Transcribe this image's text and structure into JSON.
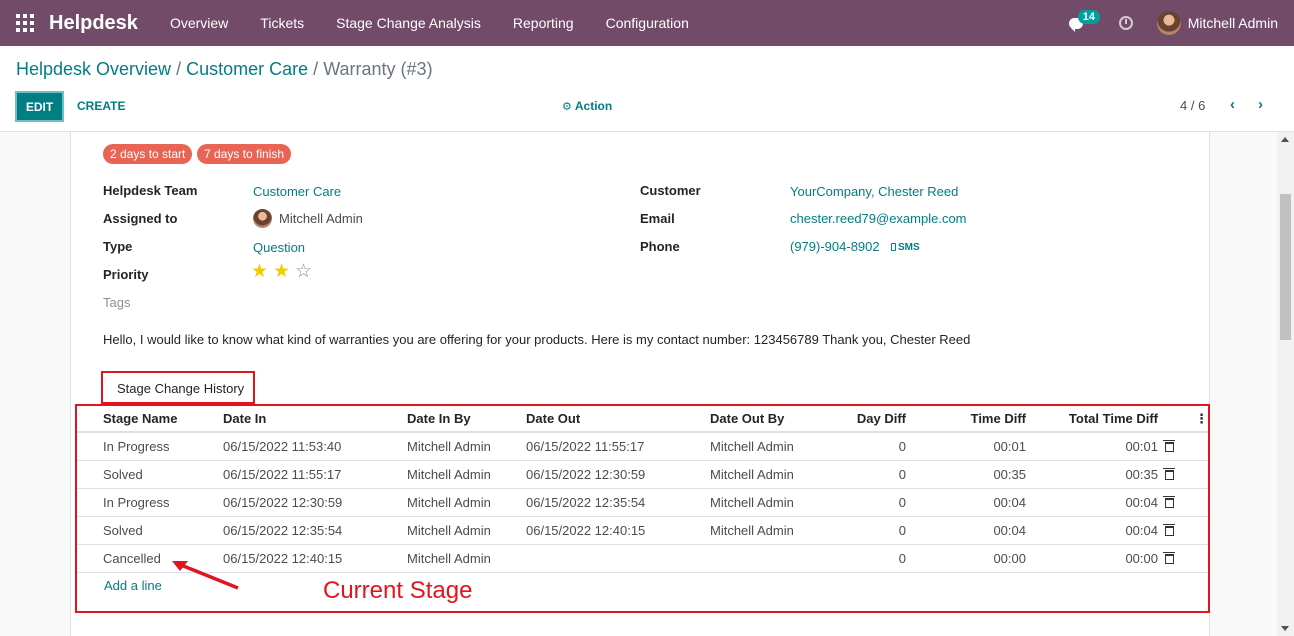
{
  "navbar": {
    "brand": "Helpdesk",
    "menu": [
      "Overview",
      "Tickets",
      "Stage Change Analysis",
      "Reporting",
      "Configuration"
    ],
    "message_count": "14",
    "user": "Mitchell Admin"
  },
  "control": {
    "breadcrumb": [
      "Helpdesk Overview",
      "Customer Care",
      "Warranty (#3)"
    ],
    "edit_label": "EDIT",
    "create_label": "CREATE",
    "action_label": "Action",
    "pager": "4 / 6"
  },
  "form": {
    "chips": [
      "2 days to start",
      "7 days to finish"
    ],
    "fields": {
      "team_label": "Helpdesk Team",
      "team_value": "Customer Care",
      "assigned_label": "Assigned to",
      "assigned_value": "Mitchell Admin",
      "type_label": "Type",
      "type_value": "Question",
      "priority_label": "Priority",
      "priority_stars": 2,
      "priority_max": 3,
      "tags_label": "Tags",
      "customer_label": "Customer",
      "customer_value": "YourCompany, Chester Reed",
      "email_label": "Email",
      "email_value": "chester.reed79@example.com",
      "phone_label": "Phone",
      "phone_value": "(979)-904-8902",
      "sms_label": "SMS"
    },
    "description": "Hello, I would like to know what kind of warranties you are offering for your products. Here is my contact number: 123456789 Thank you, Chester Reed",
    "tab_label": "Stage Change History"
  },
  "history": {
    "columns": [
      "Stage Name",
      "Date In",
      "Date In By",
      "Date Out",
      "Date Out By",
      "Day Diff",
      "Time Diff",
      "Total Time Diff"
    ],
    "rows": [
      [
        "In Progress",
        "06/15/2022 11:53:40",
        "Mitchell Admin",
        "06/15/2022 11:55:17",
        "Mitchell Admin",
        "0",
        "00:01",
        "00:01"
      ],
      [
        "Solved",
        "06/15/2022 11:55:17",
        "Mitchell Admin",
        "06/15/2022 12:30:59",
        "Mitchell Admin",
        "0",
        "00:35",
        "00:35"
      ],
      [
        "In Progress",
        "06/15/2022 12:30:59",
        "Mitchell Admin",
        "06/15/2022 12:35:54",
        "Mitchell Admin",
        "0",
        "00:04",
        "00:04"
      ],
      [
        "Solved",
        "06/15/2022 12:35:54",
        "Mitchell Admin",
        "06/15/2022 12:40:15",
        "Mitchell Admin",
        "0",
        "00:04",
        "00:04"
      ],
      [
        "Cancelled",
        "06/15/2022 12:40:15",
        "Mitchell Admin",
        "",
        "",
        "0",
        "00:00",
        "00:00"
      ]
    ],
    "add_line": "Add a line"
  },
  "annotation": {
    "text": "Current Stage",
    "color": "#e2141d"
  }
}
